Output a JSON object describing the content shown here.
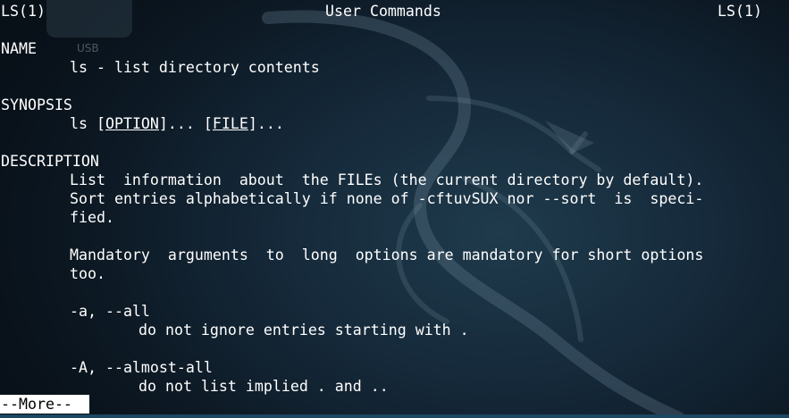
{
  "header": {
    "left": "LS(1)",
    "center": "User Commands",
    "right": "LS(1)"
  },
  "desktop": {
    "usb_label": "USB"
  },
  "sections": {
    "name_heading": "NAME",
    "name_text": "ls - list directory contents",
    "synopsis_heading": "SYNOPSIS",
    "synopsis_cmd": "ls",
    "synopsis_option": "OPTION",
    "synopsis_file": "FILE",
    "description_heading": "DESCRIPTION",
    "desc_line1": "List  information  about  the FILEs (the current directory by default).",
    "desc_line2": "Sort entries alphabetically if none of -cftuvSUX nor --sort  is  speci-",
    "desc_line3": "fied.",
    "desc_line4": "Mandatory  arguments  to  long  options are mandatory for short options",
    "desc_line5": "too.",
    "opt_a_flag": "-a, --all",
    "opt_a_desc": "do not ignore entries starting with .",
    "opt_A_flag": "-A, --almost-all",
    "opt_A_desc": "do not list implied . and .."
  },
  "pager": {
    "prompt": "--More--"
  },
  "colors": {
    "text": "#ffffff",
    "background": "#0d1a24",
    "prompt_bg": "#ffffff",
    "prompt_fg": "#000000"
  }
}
